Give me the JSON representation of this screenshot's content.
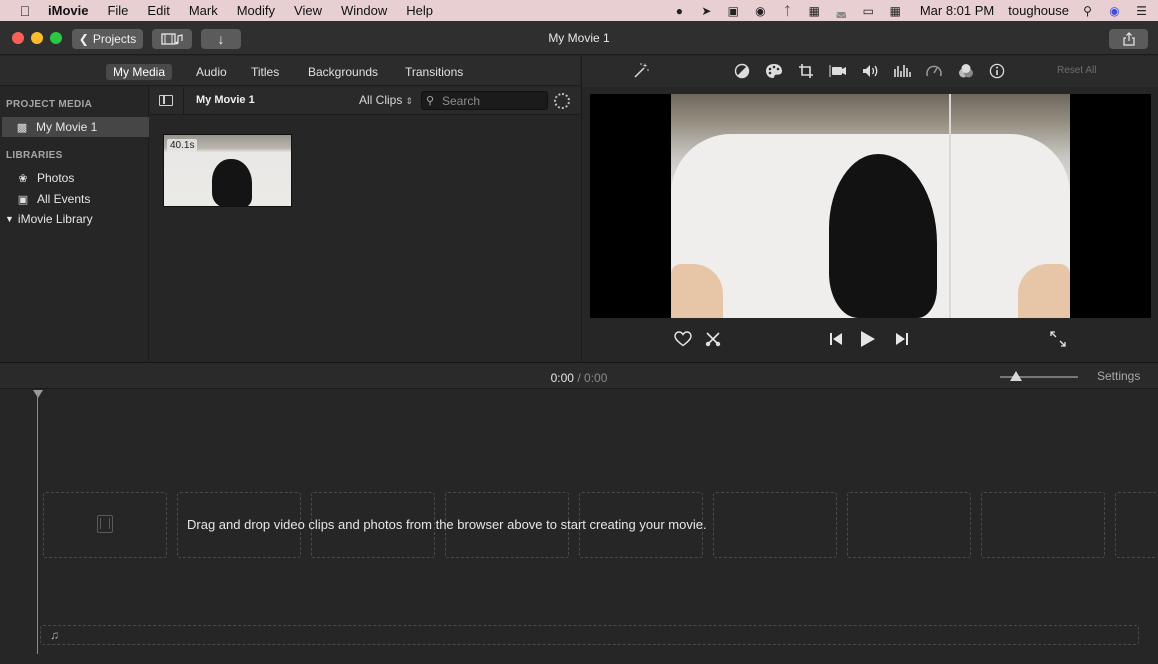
{
  "menubar": {
    "apple": "",
    "app": "iMovie",
    "items": [
      "File",
      "Edit",
      "Mark",
      "Modify",
      "View",
      "Window",
      "Help"
    ],
    "clock": "Mar 8:01 PM",
    "user": "toughouse",
    "icons": [
      "qq-icon",
      "paper-plane-icon",
      "display-icon",
      "wechat-icon",
      "bluetooth-icon",
      "keyboard-icon",
      "wifi-icon",
      "battery-icon",
      "input-method-icon",
      "search-icon",
      "siri-icon",
      "list-icon"
    ]
  },
  "toolbar": {
    "projects_label": "Projects",
    "window_title": "My Movie 1"
  },
  "media_tabs": [
    "My Media",
    "Audio",
    "Titles",
    "Backgrounds",
    "Transitions"
  ],
  "sidebar": {
    "project_media_header": "PROJECT MEDIA",
    "project_item": "My Movie 1",
    "libraries_header": "LIBRARIES",
    "items": [
      "Photos",
      "All Events",
      "iMovie Library"
    ]
  },
  "browser": {
    "title": "My Movie 1",
    "filter": "All Clips",
    "search_placeholder": "Search",
    "clip_duration": "40.1s"
  },
  "viewer": {
    "reset_label": "Reset All",
    "tools": [
      "magic-wand-icon",
      "color-balance-icon",
      "color-correction-icon",
      "crop-icon",
      "stabilization-icon",
      "volume-icon",
      "noise-reduction-icon",
      "speed-icon",
      "filter-icon",
      "info-icon"
    ]
  },
  "timeline": {
    "current": "0:00",
    "separator": "/",
    "total": "0:00",
    "settings_label": "Settings",
    "drop_hint": "Drag and drop video clips and photos from the browser above to start creating your movie."
  },
  "colors": {
    "menubar": "#e8cfd2",
    "window": "#262626",
    "toolbar": "#2f2f2f",
    "close": "#fc5f57",
    "minimize": "#fdbc2e",
    "zoom": "#29c840"
  }
}
